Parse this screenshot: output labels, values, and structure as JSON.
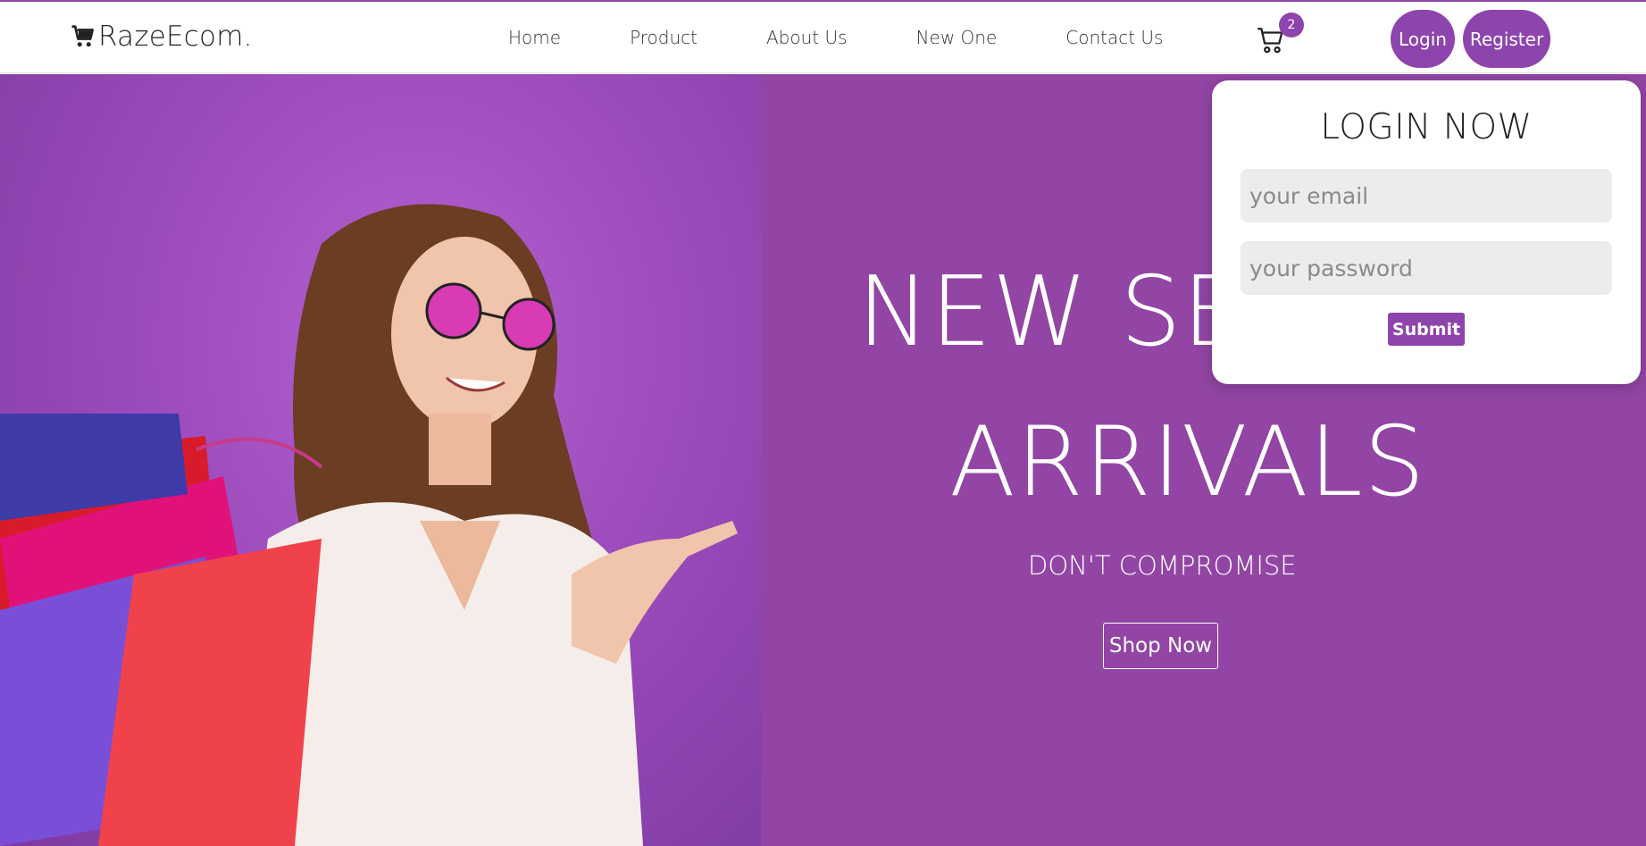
{
  "brand": {
    "name": "RazeEcom."
  },
  "nav": {
    "links": [
      {
        "label": "Home"
      },
      {
        "label": "Product"
      },
      {
        "label": "About Us"
      },
      {
        "label": "New One"
      },
      {
        "label": "Contact Us"
      }
    ]
  },
  "cart": {
    "count": "2",
    "icon": "cart-icon"
  },
  "auth": {
    "login_label": "Login",
    "register_label": "Register"
  },
  "hero": {
    "title_line1": "NEW SEA",
    "title_line2": "ARRIVALS",
    "subtitle": "DON'T COMPROMISE",
    "cta_label": "Shop Now",
    "image_desc": "woman with shopping bags"
  },
  "login_popup": {
    "title": "LOGIN NOW",
    "email_placeholder": "your email",
    "password_placeholder": "your password",
    "submit_label": "Submit"
  },
  "colors": {
    "accent": "#8e44ad",
    "hero_bg": "#9245a4"
  }
}
